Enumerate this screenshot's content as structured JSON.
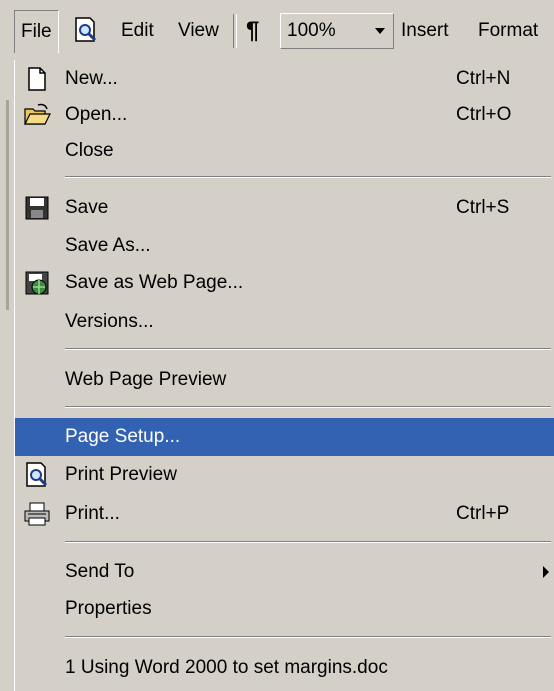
{
  "menubar": {
    "file": "File",
    "edit": "Edit",
    "view": "View",
    "paragraph_mark": "¶",
    "zoom": "100%",
    "insert": "Insert",
    "format": "Format"
  },
  "menu": {
    "items": [
      {
        "label": "New...",
        "shortcut": "Ctrl+N",
        "icon": "new-document-icon"
      },
      {
        "label": "Open...",
        "shortcut": "Ctrl+O",
        "icon": "open-folder-icon"
      },
      {
        "label": "Close",
        "shortcut": ""
      },
      {
        "label": "Save",
        "shortcut": "Ctrl+S",
        "icon": "save-disk-icon"
      },
      {
        "label": "Save As...",
        "shortcut": ""
      },
      {
        "label": "Save as Web Page...",
        "shortcut": "",
        "icon": "web-page-icon"
      },
      {
        "label": "Versions...",
        "shortcut": ""
      },
      {
        "label": "Web Page Preview",
        "shortcut": ""
      },
      {
        "label": "Page Setup...",
        "shortcut": "",
        "highlighted": true
      },
      {
        "label": "Print Preview",
        "shortcut": "",
        "icon": "print-preview-icon"
      },
      {
        "label": "Print...",
        "shortcut": "Ctrl+P",
        "icon": "printer-icon"
      },
      {
        "label": "Send To",
        "shortcut": "",
        "submenu": true
      },
      {
        "label": "Properties",
        "shortcut": ""
      },
      {
        "label": "1 Using Word 2000 to set margins.doc",
        "shortcut": ""
      }
    ]
  },
  "colors": {
    "menu_bg": "#d4d0c8",
    "highlight": "#3462b2"
  }
}
